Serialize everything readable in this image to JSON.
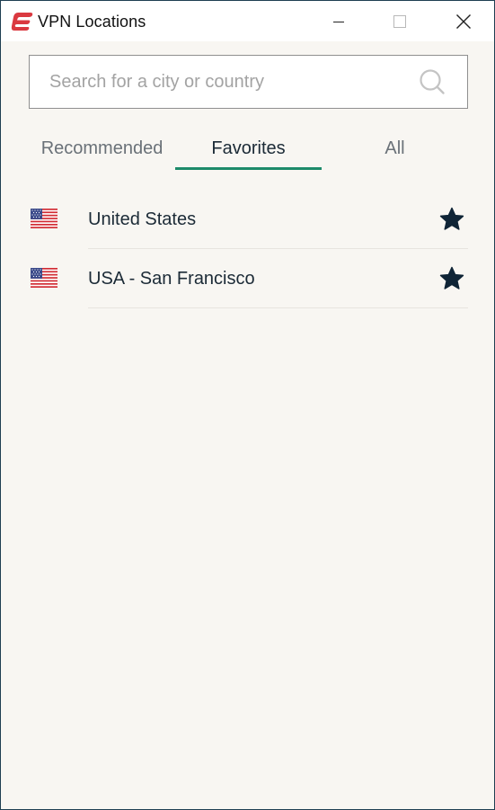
{
  "window": {
    "title": "VPN Locations",
    "controls": {
      "minimize": "minimize-icon",
      "maximize": "maximize-icon",
      "close": "close-icon"
    }
  },
  "search": {
    "placeholder": "Search for a city or country",
    "value": "",
    "icon": "search-icon"
  },
  "tabs": [
    {
      "label": "Recommended",
      "active": false
    },
    {
      "label": "Favorites",
      "active": true
    },
    {
      "label": "All",
      "active": false
    }
  ],
  "locations": [
    {
      "name": "United States",
      "flag": "us-flag-icon",
      "favorite": true
    },
    {
      "name": "USA - San Francisco",
      "flag": "us-flag-icon",
      "favorite": true
    }
  ],
  "colors": {
    "accent": "#1d8a6a",
    "brand": "#da3940",
    "star": "#0f2436",
    "background": "#f8f6f2",
    "text": "#1b2a36"
  }
}
